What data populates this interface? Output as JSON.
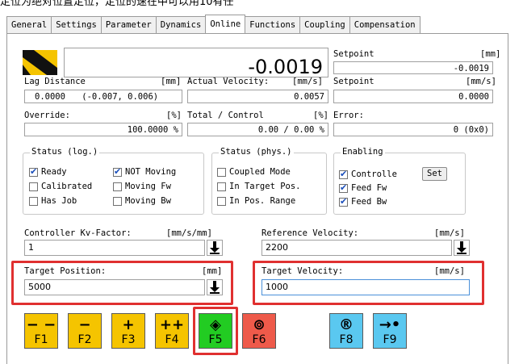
{
  "banner_text": "定位为绝对位置定位，定位的速在中可以用10有任",
  "tabs": [
    "General",
    "Settings",
    "Parameter",
    "Dynamics",
    "Online",
    "Functions",
    "Coupling",
    "Compensation"
  ],
  "active_tab": "Online",
  "position": {
    "value": "-0.0019"
  },
  "setpoint1": {
    "label": "Setpoint",
    "unit": "[mm]",
    "value": "-0.0019"
  },
  "lag": {
    "label": "Lag Distance",
    "unit": "[mm]",
    "value": "0.0000",
    "range": "(-0.007, 0.006)"
  },
  "actual_velocity": {
    "label": "Actual Velocity:",
    "unit": "[mm/s]",
    "value": "0.0057"
  },
  "setpoint2": {
    "label": "Setpoint",
    "unit": "[mm/s]",
    "value": "0.0000"
  },
  "override": {
    "label": "Override:",
    "unit": "[%]",
    "value": "100.0000 %"
  },
  "total_control": {
    "label": "Total / Control",
    "unit": "[%]",
    "value": "0.00 /  0.00 %"
  },
  "error": {
    "label": "Error:",
    "value": "0 (0x0)"
  },
  "status_log": {
    "title": "Status (log.)",
    "items": [
      {
        "label": "Ready",
        "checked": true
      },
      {
        "label": "NOT Moving",
        "checked": true
      },
      {
        "label": "Calibrated",
        "checked": false
      },
      {
        "label": "Moving Fw",
        "checked": false
      },
      {
        "label": "Has Job",
        "checked": false
      },
      {
        "label": "Moving Bw",
        "checked": false
      }
    ]
  },
  "status_phys": {
    "title": "Status (phys.)",
    "items": [
      {
        "label": "Coupled Mode",
        "checked": false
      },
      {
        "label": "In Target Pos.",
        "checked": false
      },
      {
        "label": "In Pos. Range",
        "checked": false
      }
    ]
  },
  "enabling": {
    "title": "Enabling",
    "items": [
      {
        "label": "Controlle",
        "checked": true
      },
      {
        "label": "Feed Fw",
        "checked": true
      },
      {
        "label": "Feed Bw",
        "checked": true
      }
    ],
    "set_label": "Set"
  },
  "kv": {
    "label": "Controller Kv-Factor:",
    "unit": "[mm/s/mm]",
    "value": "1"
  },
  "ref_velocity": {
    "label": "Reference Velocity:",
    "unit": "[mm/s]",
    "value": "2200"
  },
  "target_position": {
    "label": "Target Position:",
    "unit": "[mm]",
    "value": "5000"
  },
  "target_velocity": {
    "label": "Target Velocity:",
    "unit": "[mm/s]",
    "value": "1000"
  },
  "fkeys": [
    {
      "sym": "− −",
      "label": "F1",
      "color": "#f5c400"
    },
    {
      "sym": "−",
      "label": "F2",
      "color": "#f5c400"
    },
    {
      "sym": "+",
      "label": "F3",
      "color": "#f5c400"
    },
    {
      "sym": "++",
      "label": "F4",
      "color": "#f5c400"
    },
    {
      "sym": "◈",
      "label": "F5",
      "color": "#22cc22"
    },
    {
      "sym": "⊚",
      "label": "F6",
      "color": "#ee5a4a"
    },
    {
      "sym": "®",
      "label": "F8",
      "color": "#5ac8f0"
    },
    {
      "sym": "→•",
      "label": "F9",
      "color": "#5ac8f0"
    }
  ]
}
